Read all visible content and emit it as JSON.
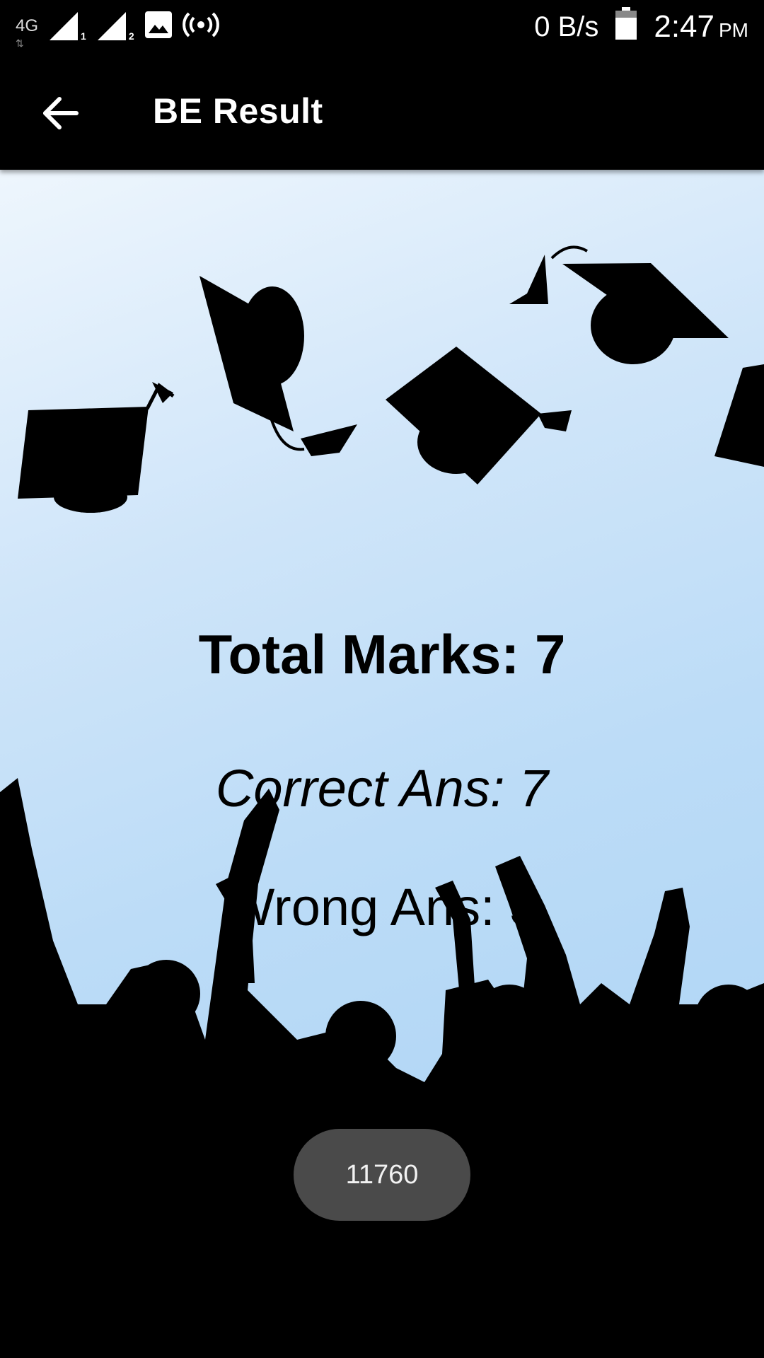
{
  "status_bar": {
    "network_type": "4G",
    "sim1": "1",
    "sim2": "2",
    "data_speed": "0 B/s",
    "time": "2:47",
    "ampm": "PM"
  },
  "app_bar": {
    "title": "BE Result"
  },
  "results": {
    "total_marks": "Total Marks: 7",
    "correct": "Correct Ans: 7",
    "wrong": "Wrong Ans: 3"
  },
  "toast": {
    "text": "11760"
  },
  "icons": {
    "back": "arrow-back-icon",
    "signal": "cell-signal-icon",
    "gallery": "image-notification-icon",
    "hotspot": "hotspot-icon",
    "battery": "battery-icon"
  }
}
